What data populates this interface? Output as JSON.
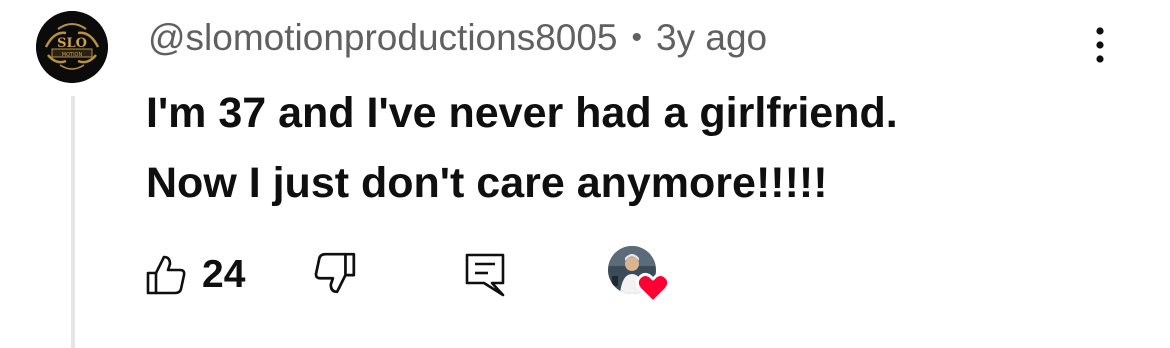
{
  "comment": {
    "avatar_logo": {
      "icon": "channel-logo-icon",
      "text": "SLO",
      "subtext": "MOTION"
    },
    "author": "@slomotionproductions8005",
    "separator": "•",
    "age": "3y ago",
    "text_lines": [
      "I'm 37 and I've never had a girlfriend.",
      "Now I just don't care anymore!!!!!"
    ],
    "like_count": "24",
    "more_icon": "more-vertical-icon",
    "like_icon": "thumbs-up-icon",
    "dislike_icon": "thumbs-down-icon",
    "reply_icon": "reply-comment-icon",
    "creator_heart_icon": "creator-heart-icon"
  },
  "colors": {
    "text_primary": "#0f0f0f",
    "text_secondary": "#606060",
    "thread_line": "#e5e5e5",
    "heart_red": "#ff0033",
    "logo_gold": "#b8913e"
  }
}
